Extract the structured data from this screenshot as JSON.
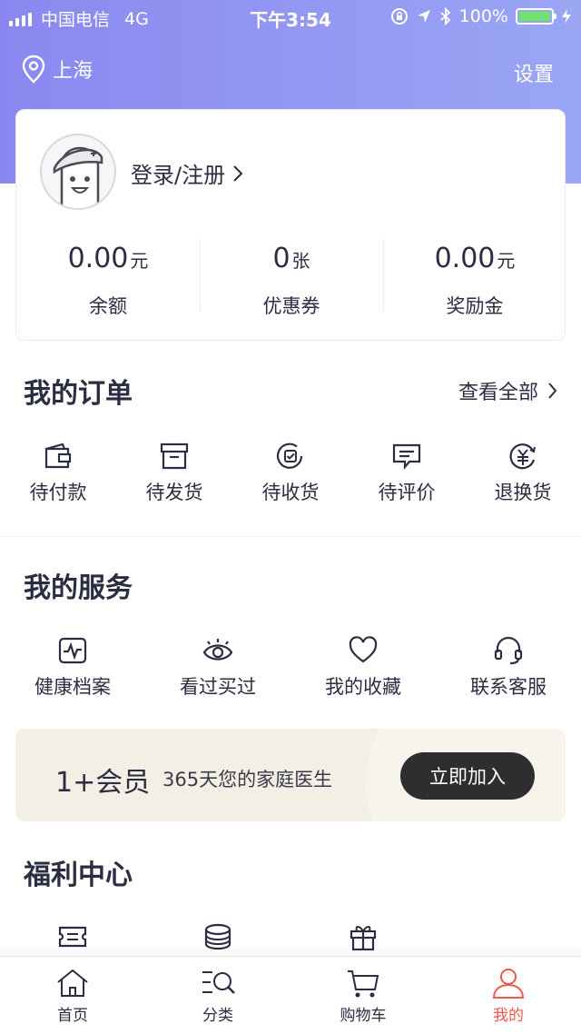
{
  "status_bar": {
    "carrier": "中国电信",
    "network": "4G",
    "time": "下午3:54",
    "battery": "100%"
  },
  "header": {
    "location": "上海",
    "settings_label": "设置"
  },
  "profile": {
    "login_label": "登录/注册"
  },
  "stats": [
    {
      "value": "0.00",
      "unit": "元",
      "label": "余额"
    },
    {
      "value": "0",
      "unit": "张",
      "label": "优惠券"
    },
    {
      "value": "0.00",
      "unit": "元",
      "label": "奖励金"
    }
  ],
  "orders": {
    "title": "我的订单",
    "view_all": "查看全部",
    "items": [
      {
        "label": "待付款",
        "icon": "wallet-icon"
      },
      {
        "label": "待发货",
        "icon": "box-icon"
      },
      {
        "label": "待收货",
        "icon": "receive-icon"
      },
      {
        "label": "待评价",
        "icon": "comment-icon"
      },
      {
        "label": "退换货",
        "icon": "refund-icon"
      }
    ]
  },
  "services": {
    "title": "我的服务",
    "items": [
      {
        "label": "健康档案",
        "icon": "health-record-icon"
      },
      {
        "label": "看过买过",
        "icon": "eye-icon"
      },
      {
        "label": "我的收藏",
        "icon": "heart-icon"
      },
      {
        "label": "联系客服",
        "icon": "headset-icon"
      }
    ]
  },
  "membership": {
    "title": "1+会员",
    "subtitle": "365天您的家庭医生",
    "button": "立即加入"
  },
  "welfare": {
    "title": "福利中心",
    "icons": [
      "ticket-icon",
      "coins-icon",
      "gift-icon"
    ]
  },
  "tabbar": {
    "items": [
      {
        "label": "首页",
        "icon": "home-icon"
      },
      {
        "label": "分类",
        "icon": "category-search-icon"
      },
      {
        "label": "购物车",
        "icon": "cart-icon"
      },
      {
        "label": "我的",
        "icon": "user-icon"
      }
    ],
    "active_index": 3,
    "active_color": "#f4554f"
  },
  "colors": {
    "header_gradient_start": "#8a88f0",
    "header_gradient_end": "#9aa6f4",
    "text": "#2b2d42",
    "banner_bg": "#f3efe5"
  }
}
